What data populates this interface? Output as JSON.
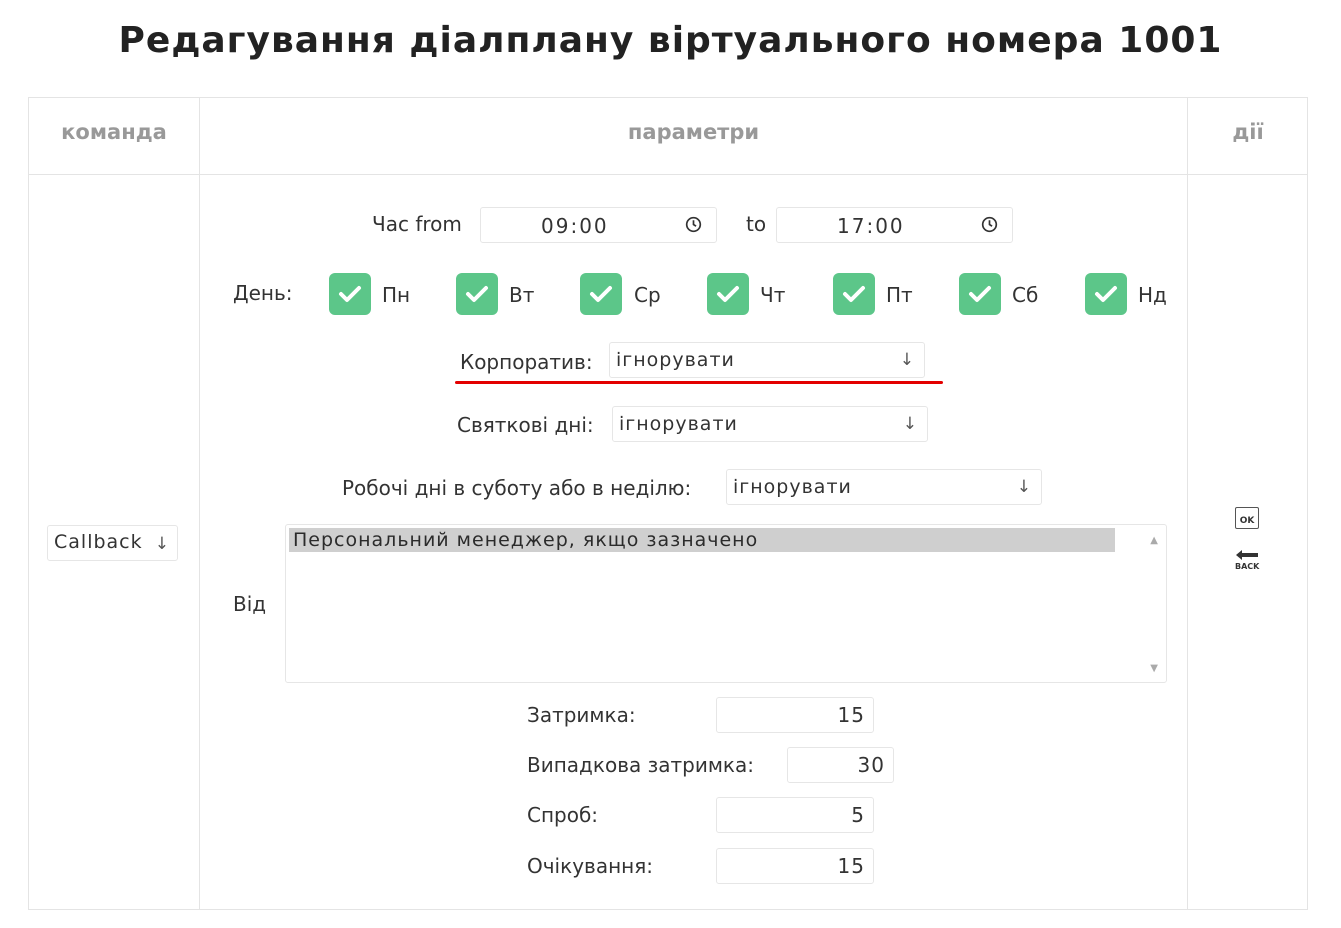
{
  "page_title": "Редагування діалплану віртуального номера 1001",
  "table": {
    "headers": {
      "command": "команда",
      "params": "параметри",
      "actions": "дії"
    }
  },
  "command_select": {
    "value": "Callback",
    "arrow": "↓"
  },
  "time": {
    "label_from": "Час from",
    "from_value": "09:00",
    "label_to": "to",
    "to_value": "17:00"
  },
  "days": {
    "label": "День:",
    "items": [
      {
        "label": "Пн",
        "checked": true
      },
      {
        "label": "Вт",
        "checked": true
      },
      {
        "label": "Ср",
        "checked": true
      },
      {
        "label": "Чт",
        "checked": true
      },
      {
        "label": "Пт",
        "checked": true
      },
      {
        "label": "Сб",
        "checked": true
      },
      {
        "label": "Нд",
        "checked": true
      }
    ]
  },
  "corporate": {
    "label": "Корпоратив:",
    "value": "ігнорувати",
    "arrow": "↓"
  },
  "holidays": {
    "label": "Святкові дні:",
    "value": "ігнорувати",
    "arrow": "↓"
  },
  "weekend_workdays": {
    "label": "Робочі дні в суботу або в неділю:",
    "value": "ігнорувати",
    "arrow": "↓"
  },
  "from": {
    "label": "Від",
    "options": [
      "Персональний менеджер, якщо зазначено"
    ]
  },
  "delay": {
    "label": "Затримка:",
    "value": "15"
  },
  "random_delay": {
    "label": "Випадкова затримка:",
    "value": "30"
  },
  "attempts": {
    "label": "Спроб:",
    "value": "5"
  },
  "waiting": {
    "label": "Очікування:",
    "value": "15"
  },
  "actions": {
    "ok_label": "OK",
    "back_label": "BACK"
  },
  "colors": {
    "checkbox": "#5cc689",
    "highlight_underline": "#e30000"
  }
}
